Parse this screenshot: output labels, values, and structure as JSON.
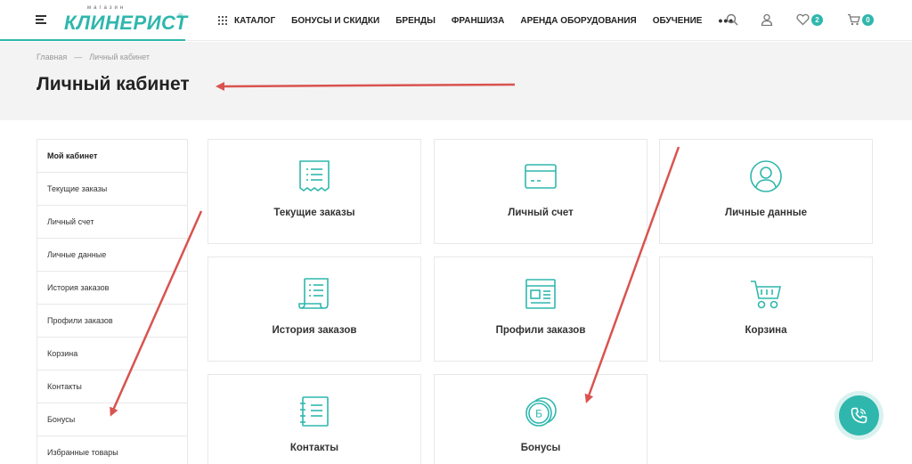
{
  "header": {
    "logo_small": "магазин",
    "logo_big": "КЛИНЕРИСТ",
    "logo_reg": "®",
    "nav": [
      "КАТАЛОГ",
      "БОНУСЫ И СКИДКИ",
      "БРЕНДЫ",
      "ФРАНШИЗА",
      "АРЕНДА ОБОРУДОВАНИЯ",
      "ОБУЧЕНИЕ"
    ],
    "more": "•••",
    "favorites_count": "2",
    "cart_count": "0"
  },
  "breadcrumb": {
    "home": "Главная",
    "sep": "—",
    "current": "Личный кабинет"
  },
  "page_title": "Личный кабинет",
  "sidebar": {
    "items": [
      "Мой кабинет",
      "Текущие заказы",
      "Личный счет",
      "Личные данные",
      "История заказов",
      "Профили заказов",
      "Корзина",
      "Контакты",
      "Бонусы",
      "Избранные товары"
    ]
  },
  "cards": [
    {
      "label": "Текущие заказы",
      "icon": "receipt-icon"
    },
    {
      "label": "Личный счет",
      "icon": "card-icon"
    },
    {
      "label": "Личные данные",
      "icon": "user-icon"
    },
    {
      "label": "История заказов",
      "icon": "scroll-icon"
    },
    {
      "label": "Профили заказов",
      "icon": "profile-doc-icon"
    },
    {
      "label": "Корзина",
      "icon": "cart-icon"
    },
    {
      "label": "Контакты",
      "icon": "notebook-icon"
    },
    {
      "label": "Бонусы",
      "icon": "coin-icon"
    }
  ],
  "coin_letter": "Б",
  "colors": {
    "accent": "#2fb7ad",
    "arrow": "#d9534f"
  }
}
